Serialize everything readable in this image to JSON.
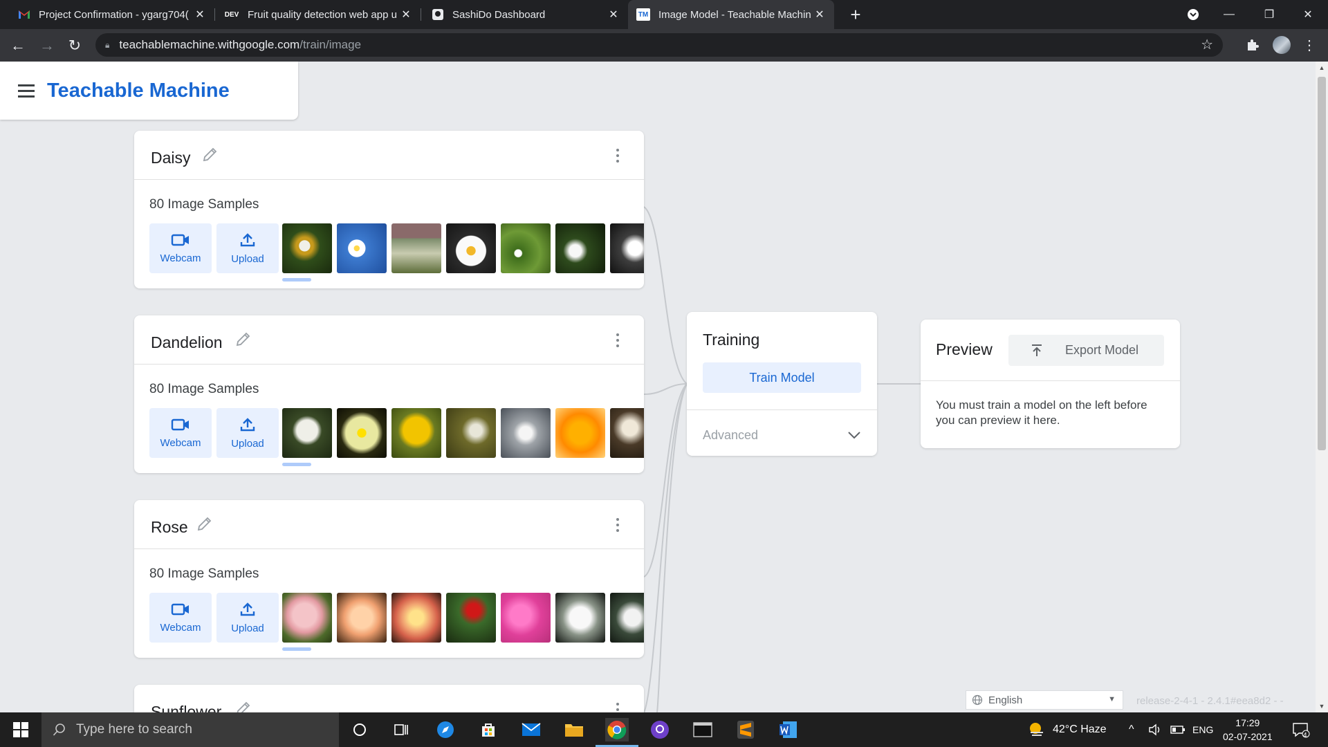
{
  "browser": {
    "tabs": [
      {
        "title": "Project Confirmation - ygarg704(",
        "icon": "gmail-icon",
        "active": false
      },
      {
        "title": "Fruit quality detection web app u",
        "icon": "dev-icon",
        "active": false
      },
      {
        "title": "SashiDo Dashboard",
        "icon": "sashido-icon",
        "active": false
      },
      {
        "title": "Image Model - Teachable Machin",
        "icon": "tm-icon",
        "active": true
      }
    ],
    "url_host": "teachablemachine.withgoogle.com",
    "url_path": "/train/image"
  },
  "app": {
    "title": "Teachable Machine"
  },
  "classes": [
    {
      "name": "Daisy",
      "samples_label": "80 Image Samples"
    },
    {
      "name": "Dandelion",
      "samples_label": "80 Image Samples"
    },
    {
      "name": "Rose",
      "samples_label": "80 Image Samples"
    },
    {
      "name": "Sunflower",
      "samples_label": ""
    }
  ],
  "sample_buttons": {
    "webcam": "Webcam",
    "upload": "Upload"
  },
  "training": {
    "title": "Training",
    "train_button": "Train Model",
    "advanced": "Advanced"
  },
  "preview": {
    "title": "Preview",
    "export_button": "Export Model",
    "message": "You must train a model on the left before you can preview it here."
  },
  "footer": {
    "language": "English",
    "release": "release-2-4-1 - 2.4.1#eea8d2 - -"
  },
  "taskbar": {
    "search_placeholder": "Type here to search",
    "weather": "42°C  Haze",
    "language": "ENG",
    "time": "17:29",
    "date": "02-07-2021",
    "notifications": "4"
  },
  "colors": {
    "accent": "#1967d2",
    "accent_light": "#e8f0fe",
    "page_bg": "#e8eaed"
  }
}
